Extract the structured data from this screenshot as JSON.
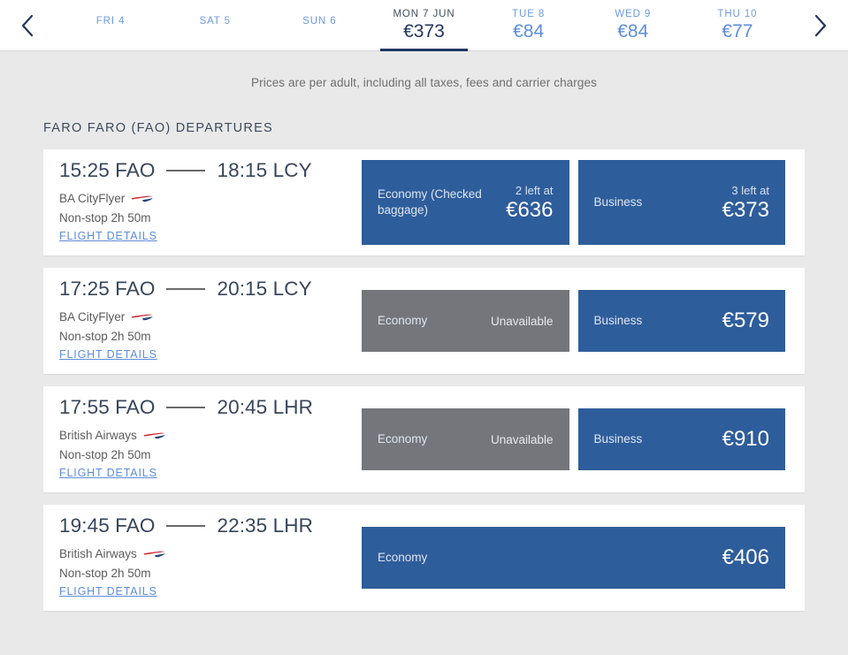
{
  "date_nav": {
    "prev_label": "previous dates",
    "next_label": "next dates",
    "days": [
      {
        "label": "FRI 4",
        "price": "",
        "selected": false
      },
      {
        "label": "SAT 5",
        "price": "",
        "selected": false
      },
      {
        "label": "SUN 6",
        "price": "",
        "selected": false
      },
      {
        "label": "MON 7 JUN",
        "price": "€373",
        "selected": true
      },
      {
        "label": "TUE 8",
        "price": "€84",
        "selected": false
      },
      {
        "label": "WED 9",
        "price": "€84",
        "selected": false
      },
      {
        "label": "THU 10",
        "price": "€77",
        "selected": false
      }
    ]
  },
  "price_note": "Prices are per adult, including all taxes, fees and carrier charges",
  "section_title": "FARO FARO (FAO) DEPARTURES",
  "flights": [
    {
      "depart_time": "15:25",
      "depart_code": "FAO",
      "arrive_time": "18:15",
      "arrive_code": "LCY",
      "airline": "BA CityFlyer",
      "stops": "Non-stop  2h 50m",
      "details_label": "FLIGHT DETAILS",
      "fares": [
        {
          "cabin": "Economy (Checked baggage)",
          "seats": "2 left at",
          "price": "€636",
          "available": true
        },
        {
          "cabin": "Business",
          "seats": "3 left at",
          "price": "€373",
          "available": true
        }
      ]
    },
    {
      "depart_time": "17:25",
      "depart_code": "FAO",
      "arrive_time": "20:15",
      "arrive_code": "LCY",
      "airline": "BA CityFlyer",
      "stops": "Non-stop  2h 50m",
      "details_label": "FLIGHT DETAILS",
      "fares": [
        {
          "cabin": "Economy",
          "seats": "",
          "price": "",
          "unavailable_label": "Unavailable",
          "available": false
        },
        {
          "cabin": "Business",
          "seats": "",
          "price": "€579",
          "available": true
        }
      ]
    },
    {
      "depart_time": "17:55",
      "depart_code": "FAO",
      "arrive_time": "20:45",
      "arrive_code": "LHR",
      "airline": "British Airways",
      "stops": "Non-stop  2h 50m",
      "details_label": "FLIGHT DETAILS",
      "fares": [
        {
          "cabin": "Economy",
          "seats": "",
          "price": "",
          "unavailable_label": "Unavailable",
          "available": false
        },
        {
          "cabin": "Business",
          "seats": "",
          "price": "€910",
          "available": true
        }
      ]
    },
    {
      "depart_time": "19:45",
      "depart_code": "FAO",
      "arrive_time": "22:35",
      "arrive_code": "LHR",
      "airline": "British Airways",
      "stops": "Non-stop  2h 50m",
      "details_label": "FLIGHT DETAILS",
      "fares": [
        {
          "cabin": "Economy",
          "seats": "",
          "price": "€406",
          "available": true
        }
      ]
    }
  ],
  "colors": {
    "page_bg": "#e9e9e9",
    "card_bg": "#ffffff",
    "fare_available": "#2e5d9b",
    "fare_unavailable": "#74767c",
    "accent_navy": "#1f3864",
    "link_blue": "#5c8ddb",
    "speedmarque_red": "#cc2229",
    "speedmarque_blue": "#23457e"
  }
}
